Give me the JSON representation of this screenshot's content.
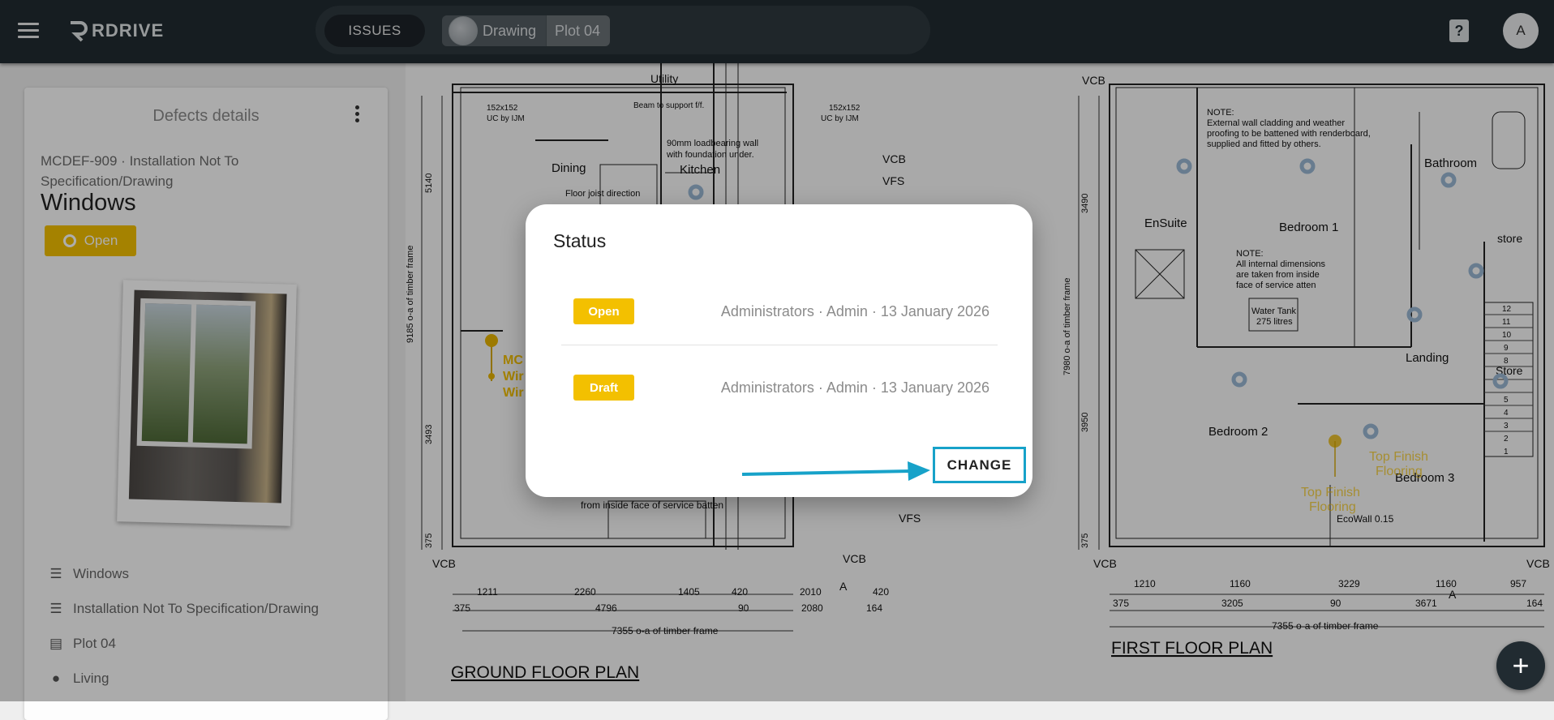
{
  "app": {
    "logo_text": "RDRIVE",
    "issues_tab": "ISSUES",
    "breadcrumbs": [
      "Drawing",
      "Plot 04"
    ],
    "help_label": "?",
    "avatar_initial": "A"
  },
  "panel": {
    "title": "Defects details",
    "defect_id": "MCDEF-909 · Installation Not To Specification/Drawing",
    "defect_title": "Windows",
    "status": "Open",
    "meta": [
      {
        "icon": "list-icon",
        "label": "Windows"
      },
      {
        "icon": "list-icon",
        "label": "Installation Not To Specification/Drawing"
      },
      {
        "icon": "map-icon",
        "label": "Plot 04"
      },
      {
        "icon": "location-pin-icon",
        "label": "Living"
      }
    ]
  },
  "drawing": {
    "ground_plan_title": "GROUND FLOOR PLAN",
    "first_plan_title": "FIRST FLOOR PLAN",
    "labels": {
      "utility": "Utility",
      "dining": "Dining",
      "kitchen": "Kitchen",
      "floor_joist": "Floor joist direction",
      "beam": "Beam to support f/f.",
      "wall_90mm": "90mm loadbearing wall",
      "wall_90mm_2": "with foundation under.",
      "uc1": "152x152",
      "uc1b": "UC by IJM",
      "vcb": "VCB",
      "vfs": "VFS",
      "bathroom": "Bathroom",
      "ensuite": "EnSuite",
      "bedroom1": "Bedroom 1",
      "bedroom2": "Bedroom 2",
      "bedroom3": "Bedroom 3",
      "landing": "Landing",
      "store": "store",
      "store2": "Store",
      "note_title": "NOTE:",
      "note1a": "External wall cladding and weather",
      "note1b": "proofing to be battened with renderboard,",
      "note1c": "supplied and fitted by others.",
      "note2a": "All internal dimensions",
      "note2b": "are taken from inside",
      "note2c": "face of service  atten",
      "water_tank": "Water Tank",
      "water_tank2": "275 litres",
      "ecowall": "EcoWall 0.15",
      "inside_face": "from inside face of service batten",
      "timber_frame_g": "7355 o-a of timber frame",
      "timber_frame_f": "7355 o-a of timber frame",
      "dims_g_top": [
        "1211",
        "2260",
        "1405",
        "420",
        "2010",
        "420"
      ],
      "dims_g_bottom": [
        "375",
        "4796",
        "90",
        "2080",
        "164"
      ],
      "dims_f_top": [
        "1210",
        "1160",
        "3229",
        "1160",
        "957"
      ],
      "dims_f_bottom": [
        "375",
        "3205",
        "90",
        "3671",
        "164"
      ],
      "section_a": "A",
      "pin_labels": [
        "MC",
        "Wir",
        "Wir"
      ],
      "top_finish": "Top Finish",
      "flooring": "Flooring",
      "stair_nums": [
        "12",
        "11",
        "10",
        "9",
        "8",
        "5",
        "4",
        "3",
        "2",
        "1"
      ],
      "vert_g": [
        "5140",
        "9185 o-a of timber frame",
        "3493",
        "375"
      ],
      "vert_f": [
        "3490",
        "7980 o-a of timber frame",
        "3950",
        "375"
      ]
    }
  },
  "dialog": {
    "title": "Status",
    "entries": [
      {
        "status": "Open",
        "meta": "Administrators · Admin · 13 January 2026"
      },
      {
        "status": "Draft",
        "meta": "Administrators · Admin · 13 January 2026"
      }
    ],
    "change_label": "CHANGE"
  },
  "fab_label": "+",
  "colors": {
    "topbar": "#212b31",
    "accent_yellow": "#f3c000",
    "highlight_blue": "#17a2c9",
    "pin_blue": "#9ab7d3"
  }
}
